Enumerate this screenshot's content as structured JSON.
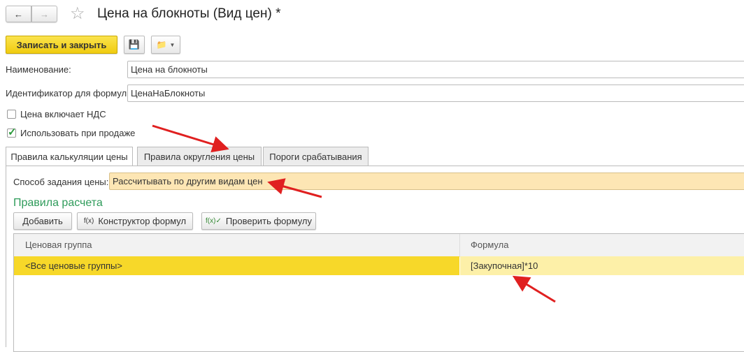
{
  "title": "Цена на блокноты (Вид цен) *",
  "toolbar": {
    "save_close": "Записать и закрыть"
  },
  "fields": {
    "name_label": "Наименование:",
    "name_value": "Цена на блокноты",
    "id_label": "Идентификатор для формул:",
    "id_value": "ЦенаНаБлокноты"
  },
  "checkboxes": [
    {
      "label": "Цена включает НДС",
      "checked": false
    },
    {
      "label": "Использовать при продаже",
      "checked": true
    }
  ],
  "tabs": [
    "Правила калькуляции цены",
    "Правила округления цены",
    "Пороги срабатывания"
  ],
  "method": {
    "label": "Способ задания цены:",
    "value": "Рассчитывать по другим видам цен"
  },
  "section_title": "Правила расчета",
  "buttons": {
    "add": "Добавить",
    "constructor": "Конструктор формул",
    "check": "Проверить формулу"
  },
  "table": {
    "columns": [
      "Ценовая группа",
      "Формула"
    ],
    "rows": [
      [
        "<Все ценовые группы>",
        "[Закупочная]*10"
      ]
    ]
  },
  "colors": {
    "accent": "#f7d829",
    "green": "#2e9b5a",
    "arrow": "#e02020"
  }
}
